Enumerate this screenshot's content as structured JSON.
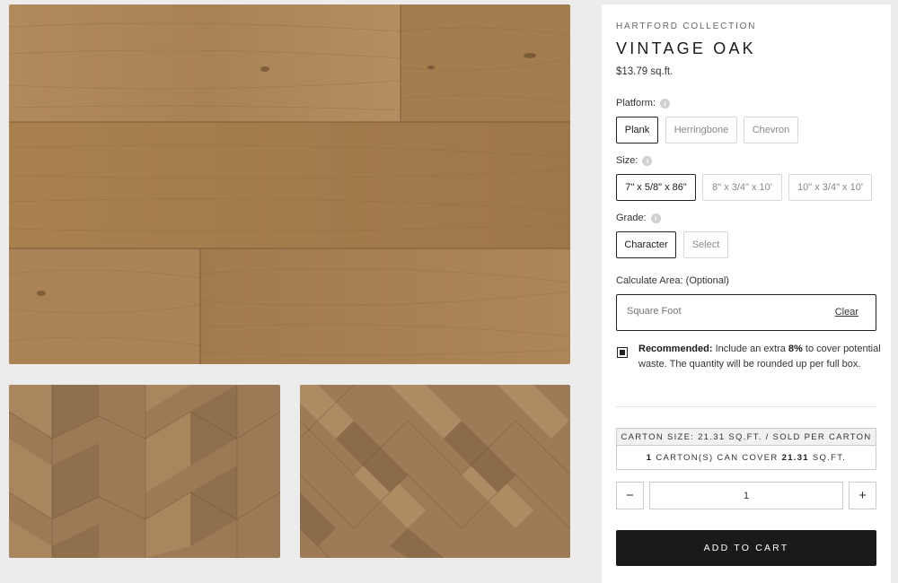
{
  "product": {
    "collection": "HARTFORD COLLECTION",
    "name": "VINTAGE OAK",
    "price": "$13.79 sq.ft."
  },
  "images": [
    {
      "name": "main-plank-image",
      "icon": "wood-plank-photo"
    },
    {
      "name": "chevron-image",
      "icon": "wood-chevron-photo"
    },
    {
      "name": "herringbone-image",
      "icon": "wood-herringbone-photo"
    }
  ],
  "platform": {
    "label": "Platform:",
    "options": [
      "Plank",
      "Herringbone",
      "Chevron"
    ],
    "selected": "Plank"
  },
  "size": {
    "label": "Size:",
    "options": [
      "7\" x 5/8\" x 86\"",
      "8\" x 3/4\" x 10'",
      "10\" x 3/4\" x 10'"
    ],
    "selected": "7\" x 5/8\" x 86\""
  },
  "grade": {
    "label": "Grade:",
    "options": [
      "Character",
      "Select"
    ],
    "selected": "Character"
  },
  "area": {
    "label": "Calculate Area: (Optional)",
    "placeholder": "Square Foot",
    "value": "",
    "clear_label": "Clear"
  },
  "recommendation": {
    "checked": true,
    "bold_lead": "Recommended:",
    "text_before": " Include an extra ",
    "percent": "8%",
    "text_after": " to cover potential waste. The quantity will be rounded up per full box."
  },
  "carton": {
    "size_text": "CARTON SIZE: 21.31 SQ.FT. / SOLD PER CARTON",
    "count": "1",
    "cover_mid": "CARTON(S) CAN COVER",
    "cover_value": "21.31",
    "cover_unit": "SQ.FT."
  },
  "quantity": {
    "minus": "−",
    "value": "1",
    "plus": "+"
  },
  "cart_button": "ADD TO CART",
  "colors": {
    "accent": "#1a1a1a",
    "wood_light": "#b48e60",
    "wood_mid": "#9b7850"
  }
}
